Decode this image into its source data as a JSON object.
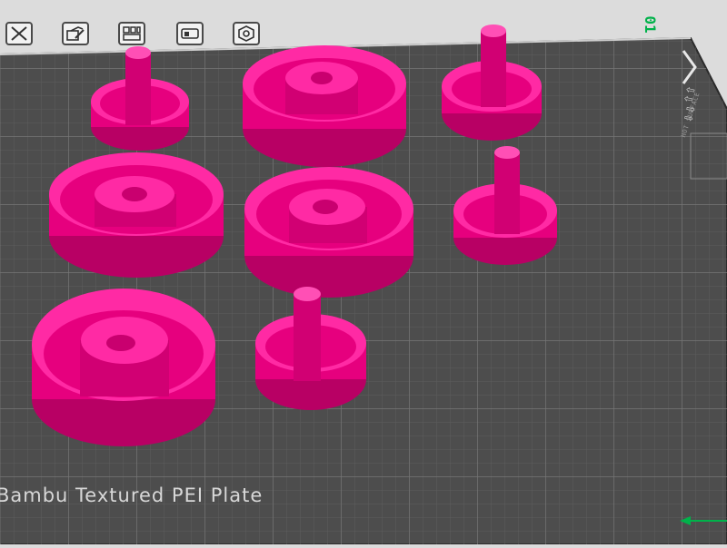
{
  "app": {
    "plate_number": "01",
    "plate_type_label": "Bambu Textured PEI Plate",
    "side_marking": "HOT SURFACE"
  },
  "toolbar": {
    "buttons": [
      {
        "name": "close-button",
        "icon": "close-icon"
      },
      {
        "name": "edit-plate-button",
        "icon": "edit-icon"
      },
      {
        "name": "arrange-button",
        "icon": "arrange-icon"
      },
      {
        "name": "orient-button",
        "icon": "orient-icon"
      },
      {
        "name": "settings-button",
        "icon": "nut-icon"
      }
    ]
  },
  "scene": {
    "objects": [
      "knob-with-post",
      "large-cup",
      "knob-with-post",
      "large-cup",
      "large-cup",
      "knob-with-post",
      "large-cup",
      "knob-with-post"
    ]
  },
  "colors": {
    "background": "#dcdcdc",
    "plate": "#4d4d4d",
    "grid": "#6c6c6c",
    "model": "#e6007e",
    "accent_green": "#00b24a"
  }
}
